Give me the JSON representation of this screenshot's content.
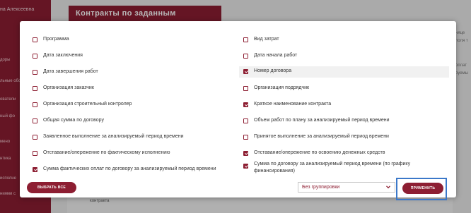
{
  "background": {
    "user": "на Алексеевна",
    "sidebar_items": [
      "доры",
      "льные обс",
      "ователи",
      "ный фо",
      "мено",
      "нтика",
      "исполне",
      "ниями с"
    ],
    "header_title": "Контракты по заданным параметрам",
    "right_texts": [
      "няце",
      "поля т",
      "оплат",
      "руемы"
    ],
    "bottom_text": "контракта"
  },
  "modal": {
    "left_options": [
      {
        "label": "Программа",
        "checked": false
      },
      {
        "label": "Дата заключения",
        "checked": false
      },
      {
        "label": "Дата завершения работ",
        "checked": false
      },
      {
        "label": "Организация заказчик",
        "checked": false
      },
      {
        "label": "Организация строительный контролер",
        "checked": false
      },
      {
        "label": "Общая сумма по договору",
        "checked": false
      },
      {
        "label": "Заявленное выполнение за анализируемый период времени",
        "checked": false
      },
      {
        "label": "Отставание/опережение по фактическому исполнению",
        "checked": false
      },
      {
        "label": "Сумма фактических оплат по договору за анализируемый период времени",
        "checked": true
      }
    ],
    "right_options": [
      {
        "label": "Вид затрат",
        "checked": false
      },
      {
        "label": "Дата начала работ",
        "checked": false
      },
      {
        "label": "Номер договора",
        "checked": true
      },
      {
        "label": "Организация подрядчик",
        "checked": false
      },
      {
        "label": "Краткое наименование контракта",
        "checked": true
      },
      {
        "label": "Объем работ по плану за анализируемый период времени",
        "checked": false
      },
      {
        "label": "Принятое выполнение за анализируемый период времени",
        "checked": false
      },
      {
        "label": "Отставание/опережение по освоению денежных средств",
        "checked": true
      },
      {
        "label": "Сумма по договору за анализируемый период времени (по графику финансирования)",
        "checked": true
      }
    ],
    "select_all_label": "Выбрать все",
    "grouping_value": "Без группировки",
    "apply_label": "Применить"
  },
  "colors": {
    "accent": "#8d1e32",
    "focus": "#3b78c9"
  }
}
